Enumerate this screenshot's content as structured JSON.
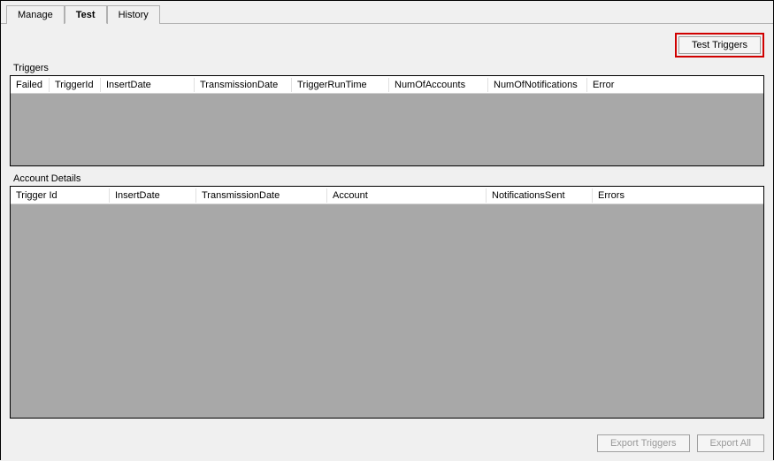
{
  "tabs": {
    "manage": "Manage",
    "test": "Test",
    "history": "History",
    "active": "test"
  },
  "buttons": {
    "test_triggers": "Test Triggers",
    "export_triggers": "Export Triggers",
    "export_all": "Export All"
  },
  "triggers_group": {
    "label": "Triggers",
    "columns": {
      "failed": "Failed",
      "trigger_id": "TriggerId",
      "insert_date": "InsertDate",
      "transmission_date": "TransmissionDate",
      "trigger_run_time": "TriggerRunTime",
      "num_accounts": "NumOfAccounts",
      "num_notifications": "NumOfNotifications",
      "error": "Error"
    },
    "rows": []
  },
  "account_group": {
    "label": "Account Details",
    "columns": {
      "trigger_id": "Trigger Id",
      "insert_date": "InsertDate",
      "transmission_date": "TransmissionDate",
      "account": "Account",
      "notifications_sent": "NotificationsSent",
      "errors": "Errors"
    },
    "rows": []
  }
}
